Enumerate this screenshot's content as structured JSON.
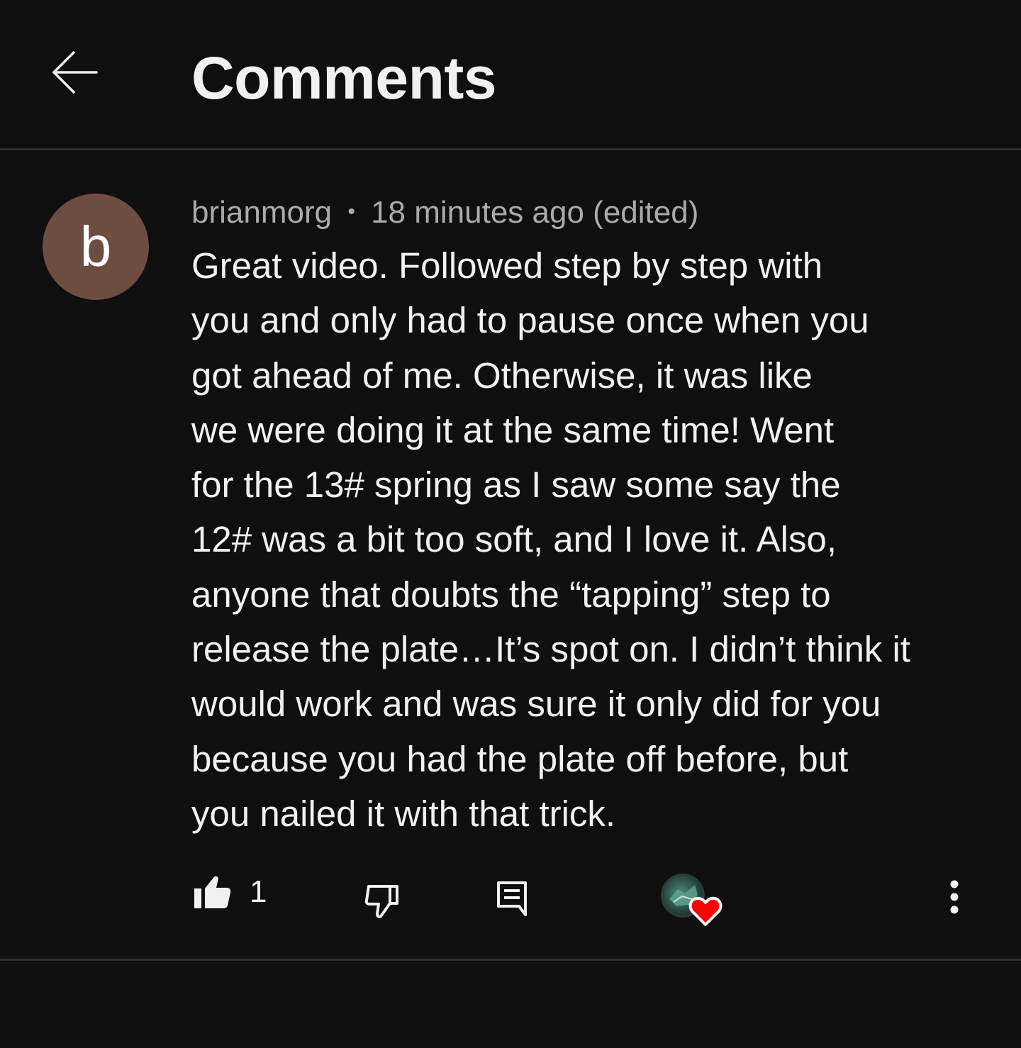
{
  "header": {
    "title": "Comments"
  },
  "comment": {
    "avatar_letter": "b",
    "avatar_color": "#6d4c41",
    "author": "brianmorg",
    "separator": "•",
    "time": "18 minutes ago (edited)",
    "text": "Great video.  Followed step by step with\nyou and only had to pause once when you\ngot ahead of me.  Otherwise, it was like\nwe were doing it at the same time!  Went\nfor the 13# spring as I saw some say the\n12# was a bit too soft, and I love it.  Also,\nanyone that doubts the “tapping” step to\nrelease the plate…It’s spot on.  I didn’t think it\nwould work and was sure it only did for you\nbecause you had the plate off before, but\nyou nailed it with that trick.",
    "like_count": "1"
  },
  "icons": {
    "back": "arrow-left-icon",
    "like": "thumbs-up-filled-icon",
    "dislike": "thumbs-down-outline-icon",
    "reply": "reply-comment-icon",
    "creator_heart": "creator-heart-icon",
    "more": "more-vertical-icon"
  },
  "colors": {
    "background": "#0f0f0f",
    "text_primary": "#f1f1f1",
    "text_secondary": "#aaaaaa",
    "divider": "#303030",
    "heart": "#ff0000"
  }
}
